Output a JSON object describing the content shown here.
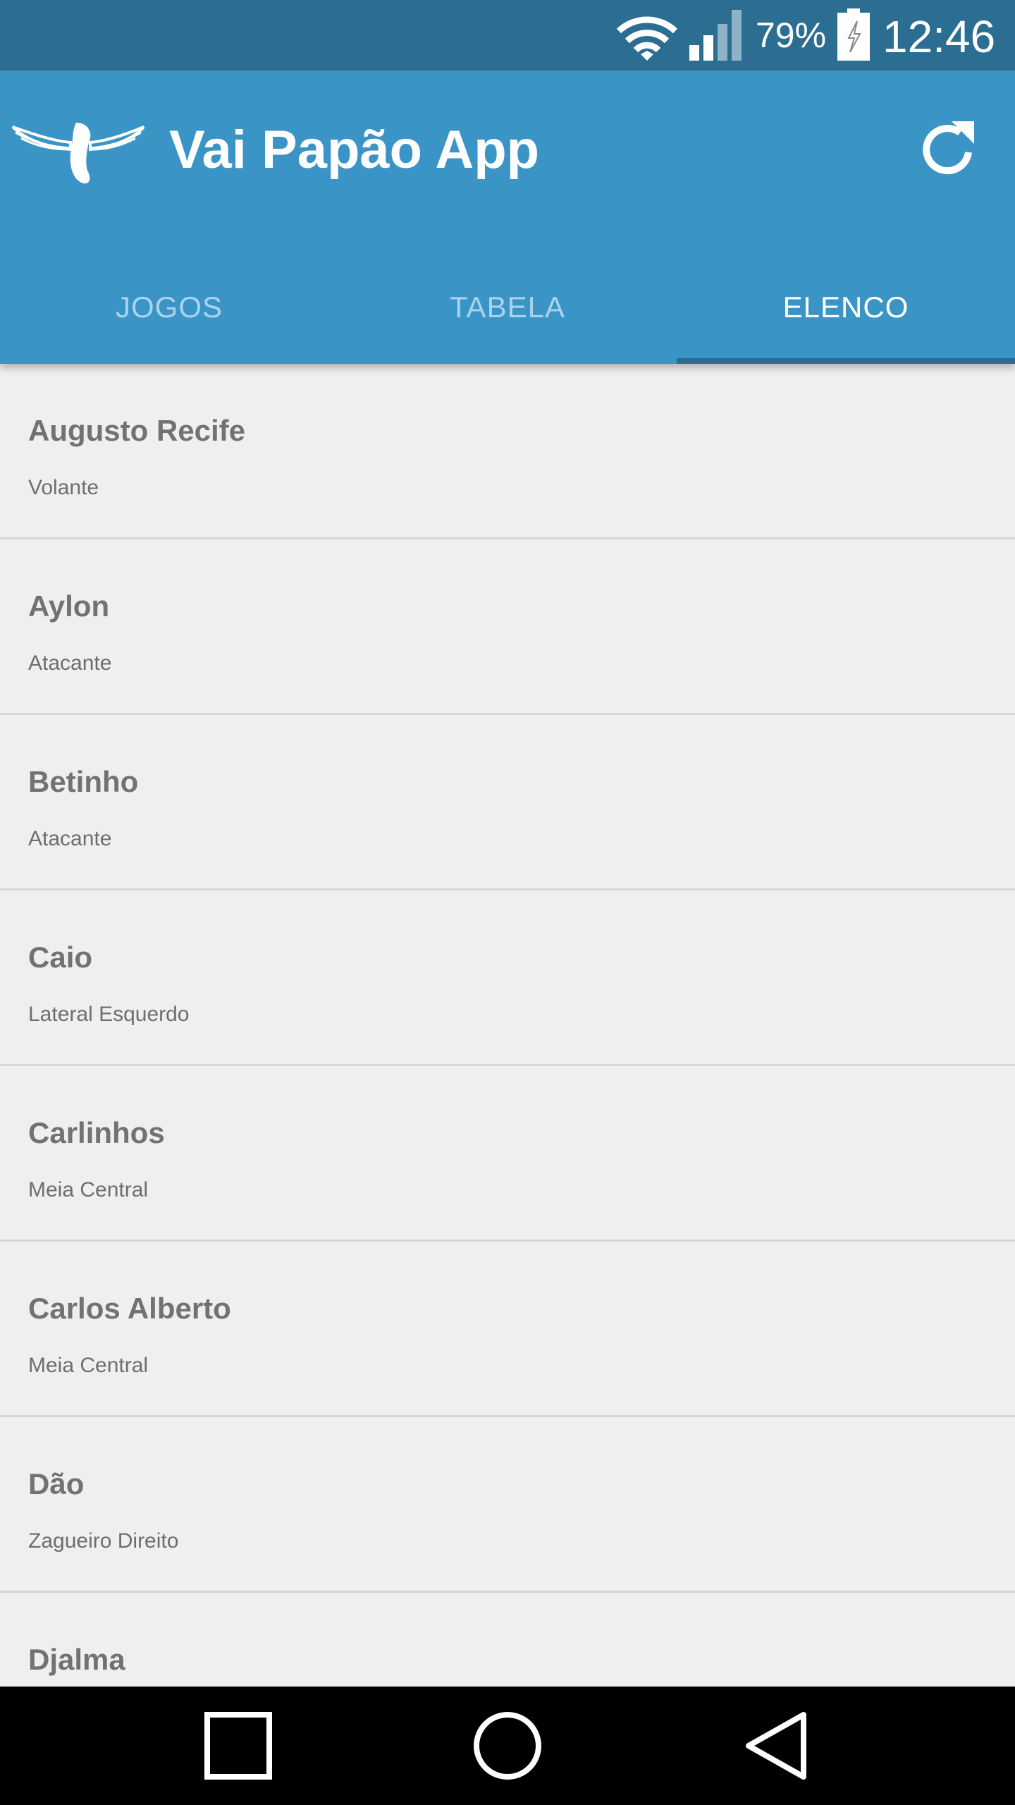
{
  "status_bar": {
    "battery_percent": "79%",
    "time": "12:46",
    "icons": [
      "wifi-icon",
      "signal-icon",
      "battery-charging-icon"
    ]
  },
  "app_bar": {
    "title": "Vai Papão App",
    "logo_icon": "winged-foot-logo",
    "refresh_icon": "refresh-icon",
    "background_color": "#3a95c6"
  },
  "tabs": [
    {
      "label": "JOGOS",
      "active": false
    },
    {
      "label": "TABELA",
      "active": false
    },
    {
      "label": "ELENCO",
      "active": true
    }
  ],
  "players": [
    {
      "name": "Augusto Recife",
      "position": "Volante"
    },
    {
      "name": "Aylon",
      "position": "Atacante"
    },
    {
      "name": "Betinho",
      "position": "Atacante"
    },
    {
      "name": "Caio",
      "position": "Lateral Esquerdo"
    },
    {
      "name": "Carlinhos",
      "position": "Meia Central"
    },
    {
      "name": "Carlos Alberto",
      "position": "Meia Central"
    },
    {
      "name": "Dão",
      "position": "Zagueiro Direito"
    },
    {
      "name": "Djalma",
      "position": ""
    }
  ],
  "nav_bar": {
    "buttons": [
      "recents-square-icon",
      "home-circle-icon",
      "back-triangle-icon"
    ]
  }
}
